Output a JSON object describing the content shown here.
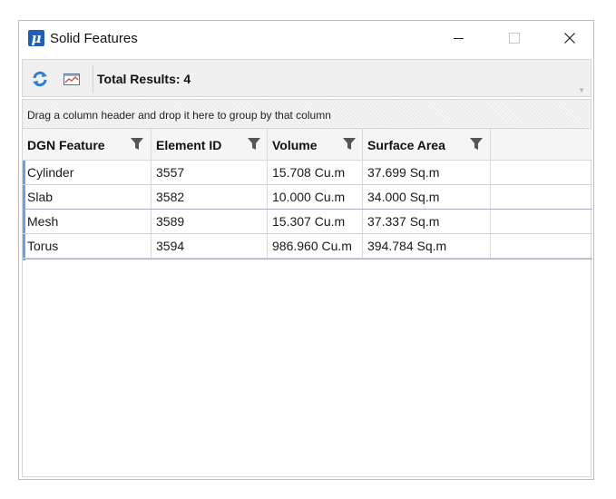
{
  "window": {
    "title": "Solid Features",
    "app_icon_glyph": "μ",
    "controls": [
      "minimize-icon",
      "maximize-icon",
      "close-icon"
    ]
  },
  "toolbar": {
    "total_results": "Total Results: 4",
    "icons": [
      "refresh-icon",
      "chart-icon"
    ]
  },
  "group_panel": {
    "hint": "Drag a column header and drop it here to group by that column"
  },
  "grid": {
    "columns": [
      "DGN Feature",
      "Element ID",
      "Volume",
      "Surface Area"
    ],
    "rows": [
      [
        "Cylinder",
        "3557",
        "15.708 Cu.m",
        "37.699 Sq.m"
      ],
      [
        "Slab",
        "3582",
        "10.000 Cu.m",
        "34.000 Sq.m"
      ],
      [
        "Mesh",
        "3589",
        "15.307 Cu.m",
        "37.337 Sq.m"
      ],
      [
        "Torus",
        "3594",
        "986.960 Cu.m",
        "394.784 Sq.m"
      ]
    ]
  },
  "colors": {
    "accent": "#1f5fb8",
    "selection_bar": "#6aa3dc",
    "refresh_icon": "#2b7fd4"
  }
}
